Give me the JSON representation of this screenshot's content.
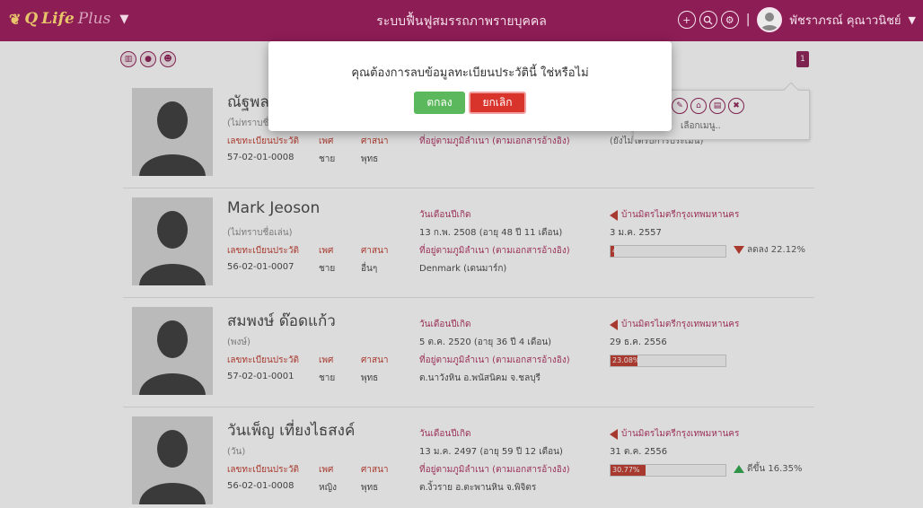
{
  "header": {
    "brand_q": "Q",
    "brand_life": "Life",
    "brand_plus": "Plus",
    "title": "ระบบฟื้นฟูสมรรถภาพรายบุคคล",
    "user_name": "พัชราภรณ์ คุณาวนิชย์",
    "separator": "|",
    "icons": [
      "plus-icon",
      "search-icon",
      "settings-icon"
    ]
  },
  "toolbar": {
    "icons": [
      "chart-icon",
      "user-icon",
      "group-icon"
    ],
    "page_number": "1"
  },
  "modal": {
    "message": "คุณต้องการลบข้อมูลทะเบียนประวัตินี้ ใช่หรือไม่",
    "ok_label": "ตกลง",
    "cancel_label": "ยกเลิก"
  },
  "popover": {
    "icons": [
      "edit-icon",
      "home-icon",
      "clipboard-icon",
      "trash-icon"
    ],
    "text": "เลือกเมนู.."
  },
  "labels": {
    "registry_no": "เลขทะเบียนประวัติ",
    "gender": "เพศ",
    "religion": "ศาสนา",
    "birthdate": "วันเดือนปีเกิด",
    "address": "ที่อยู่ตามภูมิลำเนา (ตามเอกสารอ้างอิง)",
    "agency": "บ้านมิตรไมตรีกรุงเทพมหานคร"
  },
  "records": [
    {
      "name": "ณัฐพล",
      "nickname": "(ไม่ทราบชื่อ",
      "registry_no": "57-02-01-0008",
      "gender": "ชาย",
      "religion": "พุทธ",
      "birth": "",
      "address": "",
      "agency": "",
      "date": "(ยังไม่ได้รับการประเมิน)",
      "progress": null,
      "trend": null
    },
    {
      "name": "Mark Jeoson",
      "nickname": "(ไม่ทราบชื่อเล่น)",
      "registry_no": "56-02-01-0007",
      "gender": "ชาย",
      "religion": "อื่นๆ",
      "birth": "13 ก.พ. 2508 (อายุ 48 ปี 11 เดือน)",
      "address": "Denmark (เดนมาร์ก)",
      "agency": "บ้านมิตรไมตรีกรุงเทพมหานคร",
      "date": "3 ม.ค. 2557",
      "progress": {
        "label": "4",
        "fraction": 0.03
      },
      "trend": {
        "dir": "down",
        "label": "ลดลง 22.12%"
      }
    },
    {
      "name": "สมพงษ์ ด๊อดแก้ว",
      "nickname": "(พงษ์)",
      "registry_no": "57-02-01-0001",
      "gender": "ชาย",
      "religion": "พุทธ",
      "birth": "5 ต.ค. 2520 (อายุ 36 ปี 4 เดือน)",
      "address": "ต.นาวังหิน อ.พนัสนิคม จ.ชลบุรี",
      "agency": "บ้านมิตรไมตรีกรุงเทพมหานคร",
      "date": "29 ธ.ค. 2556",
      "progress": {
        "label": "23.08%",
        "fraction": 0.2308
      },
      "trend": null
    },
    {
      "name": "วันเพ็ญ เที่ยงไธสงค์",
      "nickname": "(วัน)",
      "registry_no": "56-02-01-0008",
      "gender": "หญิง",
      "religion": "พุทธ",
      "birth": "13 ม.ค. 2497 (อายุ 59 ปี 12 เดือน)",
      "address": "ต.งิ้วราย อ.ตะพานหิน จ.พิจิตร",
      "agency": "บ้านมิตรไมตรีกรุงเทพมหานคร",
      "date": "31 ต.ค. 2556",
      "progress": {
        "label": "30.77%",
        "fraction": 0.3077
      },
      "trend": {
        "dir": "up",
        "label": "ดีขึ้น 16.35%"
      }
    }
  ]
}
